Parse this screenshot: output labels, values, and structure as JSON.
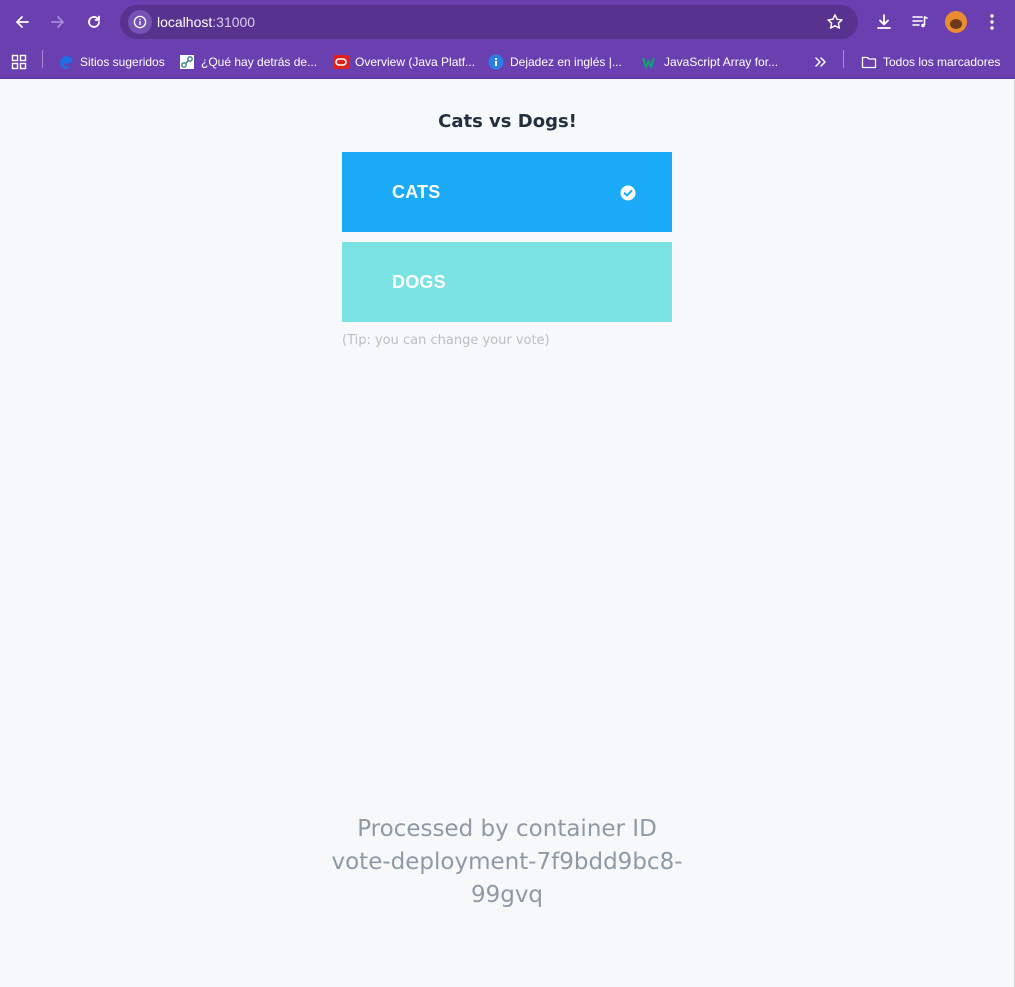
{
  "browser": {
    "url_host": "localhost",
    "url_port": ":31000",
    "bookmarks": [
      {
        "label": "Sitios sugeridos",
        "icon": "edge-favicon"
      },
      {
        "label": "¿Qué hay detrás de...",
        "icon": "diagram-favicon"
      },
      {
        "label": "Overview (Java Platf...",
        "icon": "oracle-favicon"
      },
      {
        "label": "Dejadez en inglés |...",
        "icon": "info-favicon"
      },
      {
        "label": "JavaScript Array for...",
        "icon": "w3-favicon"
      }
    ],
    "all_bookmarks_label": "Todos los marcadores",
    "accent": "#6a3fb0"
  },
  "app": {
    "title": "Cats vs Dogs!",
    "options": [
      {
        "label": "CATS",
        "color": "#1aaaf8",
        "selected": true
      },
      {
        "label": "DOGS",
        "color": "#7ae2e3",
        "selected": false
      }
    ],
    "tip": "(Tip: you can change your vote)",
    "footer": {
      "line1": "Processed by container ID",
      "line2": "vote-deployment-7f9bdd9bc8-",
      "line3": "99gvq"
    }
  }
}
